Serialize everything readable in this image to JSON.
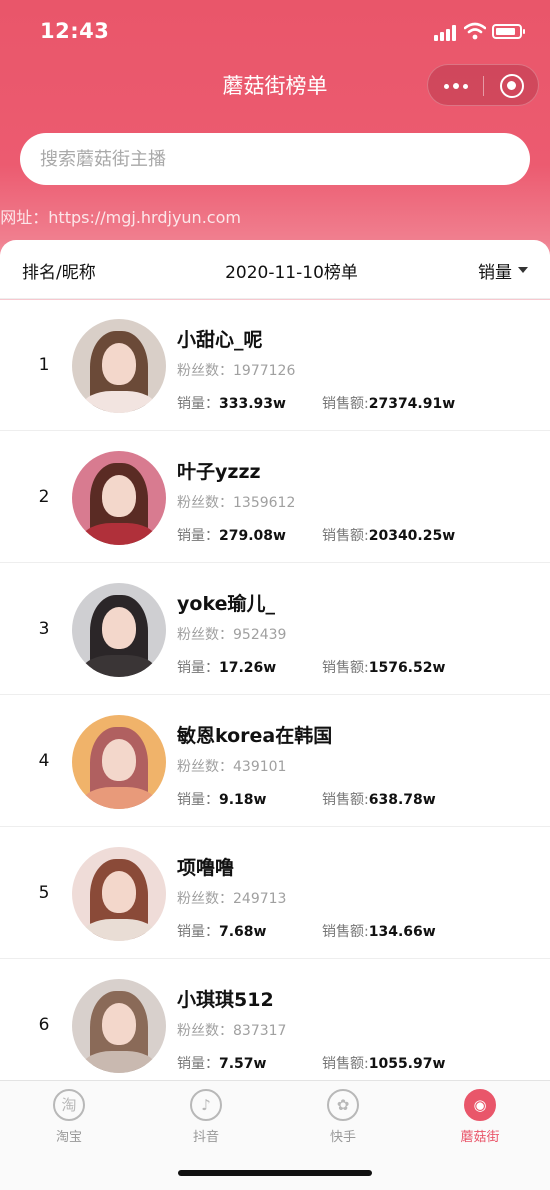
{
  "status_bar": {
    "time": "12:43",
    "icons": [
      "signal-icon",
      "wifi-icon",
      "battery-icon"
    ]
  },
  "nav": {
    "title": "蘑菇街榜单",
    "capsule_icons": [
      "more-icon",
      "close-target-icon"
    ]
  },
  "search": {
    "placeholder": "搜索蘑菇街主播"
  },
  "url_text": "t网址：https://mgj.hrdjyun.com",
  "rank_header": {
    "left_label": "排名/昵称",
    "date_label": "2020-11-10榜单",
    "sort_label": "销量",
    "sort_icon": "sort-caret-icon"
  },
  "labels": {
    "fans": "粉丝数：",
    "sales": "销量：",
    "amount": "销售额:"
  },
  "rankings": [
    {
      "rank": "1",
      "name": "小甜心_呢",
      "fans": "1977126",
      "sales": "333.93w",
      "amount": "27374.91w"
    },
    {
      "rank": "2",
      "name": "叶子yzzz",
      "fans": "1359612",
      "sales": "279.08w",
      "amount": "20340.25w"
    },
    {
      "rank": "3",
      "name": "yoke瑜儿_",
      "fans": "952439",
      "sales": "17.26w",
      "amount": "1576.52w"
    },
    {
      "rank": "4",
      "name": "敏恩korea在韩国",
      "fans": "439101",
      "sales": "9.18w",
      "amount": "638.78w"
    },
    {
      "rank": "5",
      "name": "项噜噜",
      "fans": "249713",
      "sales": "7.68w",
      "amount": "134.66w"
    },
    {
      "rank": "6",
      "name": "小琪琪512",
      "fans": "837317",
      "sales": "7.57w",
      "amount": "1055.97w"
    }
  ],
  "tabbar": {
    "tabs": [
      {
        "label": "淘宝",
        "icon": "taobao-icon",
        "glyph": "淘"
      },
      {
        "label": "抖音",
        "icon": "douyin-icon",
        "glyph": "♪"
      },
      {
        "label": "快手",
        "icon": "kuaishou-icon",
        "glyph": "✿"
      },
      {
        "label": "蘑菇街",
        "icon": "mogujie-icon",
        "glyph": "◉"
      }
    ],
    "active_index": 3
  },
  "colors": {
    "brand": "#e9566a",
    "text_primary": "#111111",
    "text_muted": "#a0a0a0"
  }
}
